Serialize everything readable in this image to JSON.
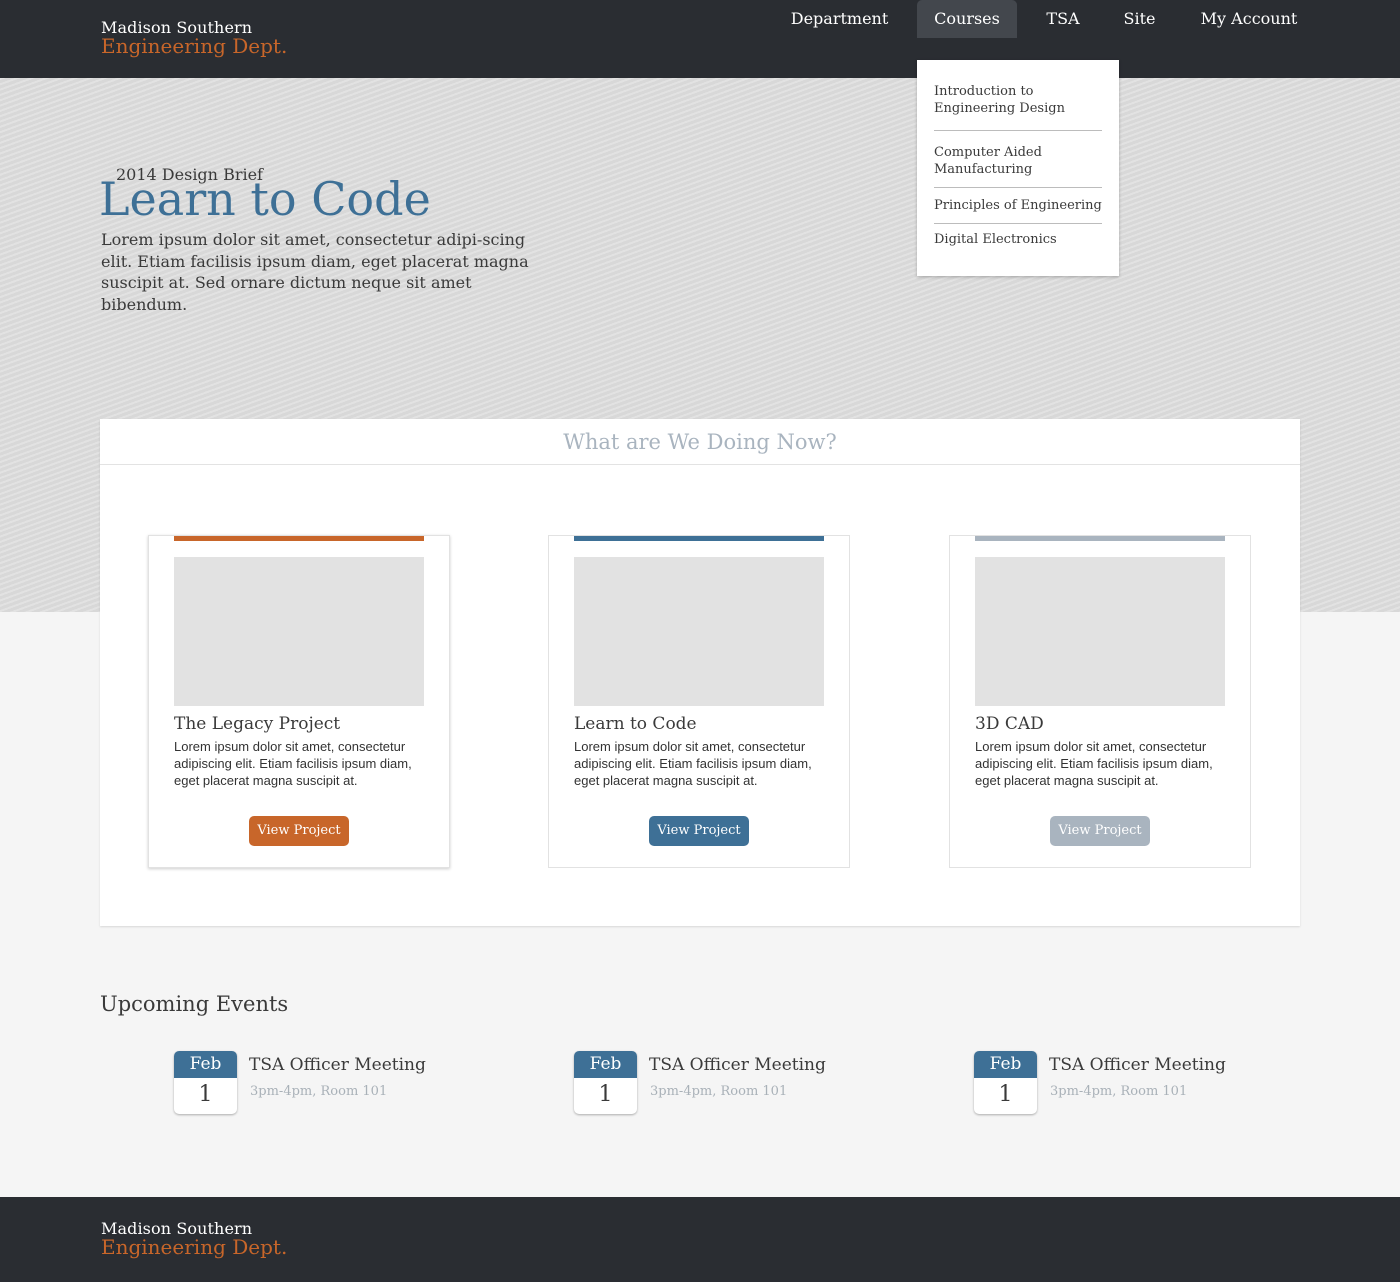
{
  "brand": {
    "line1": "Madison Southern",
    "line2": "Engineering Dept."
  },
  "nav": {
    "items": [
      {
        "label": "Department"
      },
      {
        "label": "Courses"
      },
      {
        "label": "TSA"
      },
      {
        "label": "Site"
      },
      {
        "label": "My Account"
      }
    ],
    "active": "Courses"
  },
  "courses_menu": [
    "Introduction to Engineering Design",
    "Computer Aided Manufacturing",
    "Principles of Engineering",
    "Digital Electronics"
  ],
  "hero": {
    "kicker": "2014 Design Brief",
    "title": "Learn to Code",
    "body": "Lorem ipsum dolor sit amet, consectetur adipi-scing elit. Etiam facilisis ipsum diam, eget placerat magna suscipit at. Sed ornare dictum neque sit amet bibendum."
  },
  "projects": {
    "heading": "What are We Doing Now?",
    "cards": [
      {
        "title": "The Legacy Project",
        "body": "Lorem ipsum dolor sit amet, consectetur adipiscing elit. Etiam facilisis ipsum diam, eget placerat magna suscipit at.",
        "button": "View Project",
        "color": "#c8662a"
      },
      {
        "title": "Learn to Code",
        "body": "Lorem ipsum dolor sit amet, consectetur adipiscing elit. Etiam facilisis ipsum diam, eget placerat magna suscipit at.",
        "button": "View Project",
        "color": "#3e7096"
      },
      {
        "title": "3D CAD",
        "body": "Lorem ipsum dolor sit amet, consectetur adipiscing elit. Etiam facilisis ipsum diam, eget placerat magna suscipit at.",
        "button": "View Project",
        "color": "#a9b4bf"
      }
    ]
  },
  "events": {
    "heading": "Upcoming Events",
    "items": [
      {
        "month": "Feb",
        "day": "1",
        "title": "TSA Officer Meeting",
        "meta": "3pm-4pm, Room 101"
      },
      {
        "month": "Feb",
        "day": "1",
        "title": "TSA Officer Meeting",
        "meta": "3pm-4pm, Room 101"
      },
      {
        "month": "Feb",
        "day": "1",
        "title": "TSA Officer Meeting",
        "meta": "3pm-4pm, Room 101"
      }
    ]
  },
  "footer": {
    "line1": "Madison Southern",
    "line2": "Engineering Dept."
  },
  "colors": {
    "header": "#2a2d32",
    "orange": "#c8662a",
    "blue": "#3e7096",
    "grey": "#a9b4bf"
  }
}
